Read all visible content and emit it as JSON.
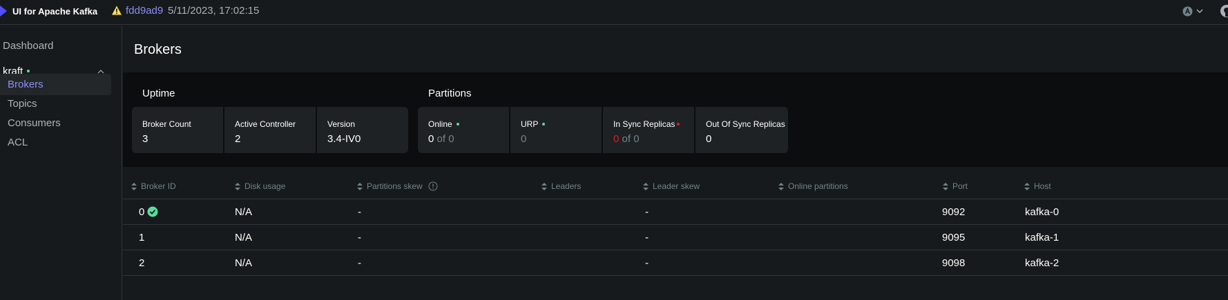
{
  "header": {
    "app_title": "UI for Apache Kafka",
    "version_hash": "fdd9ad9",
    "version_date": "5/11/2023, 17:02:15",
    "icons": [
      "kafka-logo-icon",
      "warning-icon",
      "user-avatar-icon",
      "chevron-down-icon",
      "github-icon"
    ]
  },
  "sidebar": {
    "dashboard": "Dashboard",
    "cluster_name": "kraft",
    "cluster_status_color": "#5ADD9B",
    "items": [
      {
        "label": "Brokers",
        "active": true
      },
      {
        "label": "Topics",
        "active": false
      },
      {
        "label": "Consumers",
        "active": false
      },
      {
        "label": "ACL",
        "active": false
      }
    ]
  },
  "main": {
    "title": "Brokers",
    "uptime": {
      "title": "Uptime",
      "cards": [
        {
          "label": "Broker Count",
          "value": "3"
        },
        {
          "label": "Active Controller",
          "value": "2"
        },
        {
          "label": "Version",
          "value": "3.4-IV0"
        }
      ]
    },
    "partitions": {
      "title": "Partitions",
      "cards": [
        {
          "label": "Online",
          "value": "0",
          "of": "of 0",
          "status": "green"
        },
        {
          "label": "URP",
          "value": "0",
          "status": "green"
        },
        {
          "label": "In Sync Replicas",
          "value": "0",
          "of": "of 0",
          "status": "red"
        },
        {
          "label": "Out Of Sync Replicas",
          "value": "0"
        }
      ]
    },
    "table": {
      "columns": [
        "Broker ID",
        "Disk usage",
        "Partitions skew",
        "Leaders",
        "Leader skew",
        "Online partitions",
        "Port",
        "Host"
      ],
      "rows": [
        {
          "broker_id": "0",
          "controller": true,
          "disk_usage": "N/A",
          "partitions_skew": "-",
          "leaders": "",
          "leader_skew": "-",
          "online_partitions": "",
          "port": "9092",
          "host": "kafka-0"
        },
        {
          "broker_id": "1",
          "controller": false,
          "disk_usage": "N/A",
          "partitions_skew": "-",
          "leaders": "",
          "leader_skew": "-",
          "online_partitions": "",
          "port": "9095",
          "host": "kafka-1"
        },
        {
          "broker_id": "2",
          "controller": false,
          "disk_usage": "N/A",
          "partitions_skew": "-",
          "leaders": "",
          "leader_skew": "-",
          "online_partitions": "",
          "port": "9098",
          "host": "kafka-2"
        }
      ]
    }
  },
  "colors": {
    "accent": "#8E8DF5",
    "success": "#5ADD9B",
    "danger": "#E51A1A",
    "warning": "#FFDD57"
  }
}
